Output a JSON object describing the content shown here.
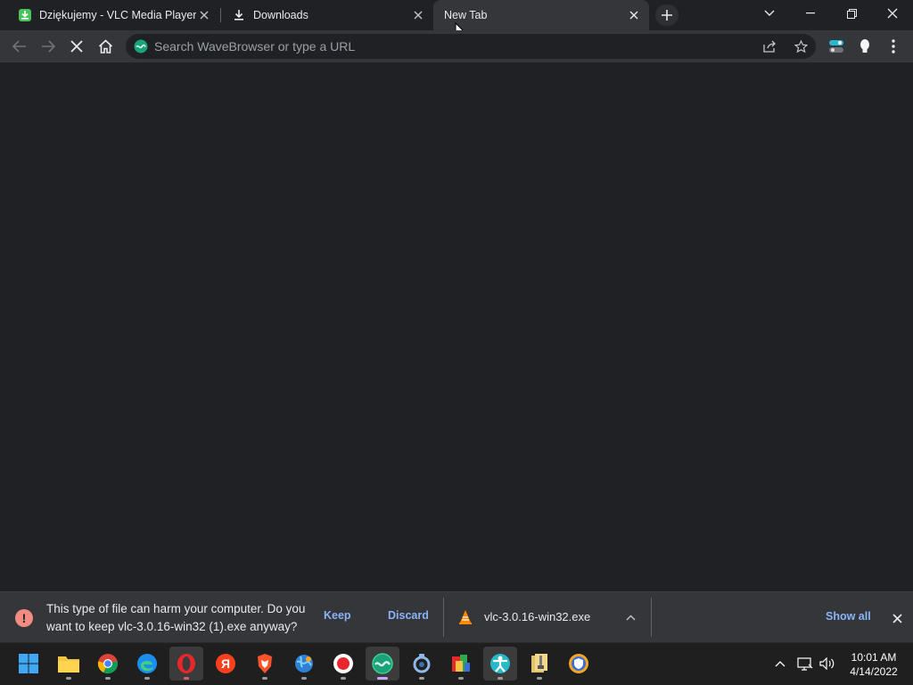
{
  "tabs": [
    {
      "title": "Dziękujemy - VLC Media Player",
      "icon": "vlc-download-icon",
      "active": false
    },
    {
      "title": "Downloads",
      "icon": "download-icon",
      "active": false
    },
    {
      "title": "New Tab",
      "icon": "",
      "active": true
    }
  ],
  "window_controls": [
    "tab-search",
    "minimize",
    "restore",
    "close"
  ],
  "toolbar": {
    "omnibox_placeholder": "Search WaveBrowser or type a URL",
    "loading": true
  },
  "download_bar": {
    "warning_text": "This type of file can harm your computer. Do you want to keep vlc-3.0.16-win32 (1).exe anyway?",
    "keep_label": "Keep",
    "discard_label": "Discard",
    "filename": "vlc-3.0.16-win32.exe",
    "show_all_label": "Show all"
  },
  "taskbar": {
    "apps": [
      "windows-start",
      "file-explorer",
      "chrome",
      "edge",
      "opera",
      "yandex",
      "brave",
      "browser-globe",
      "recorder",
      "wavebrowser",
      "app-ring",
      "app-blocks",
      "app-person",
      "archive",
      "shield-browser"
    ],
    "time": "10:01 AM",
    "date": "4/14/2022"
  },
  "colors": {
    "accent": "#8ab4f8",
    "warning": "#f28b82",
    "background": "#202124",
    "toolbar": "#35363a"
  }
}
